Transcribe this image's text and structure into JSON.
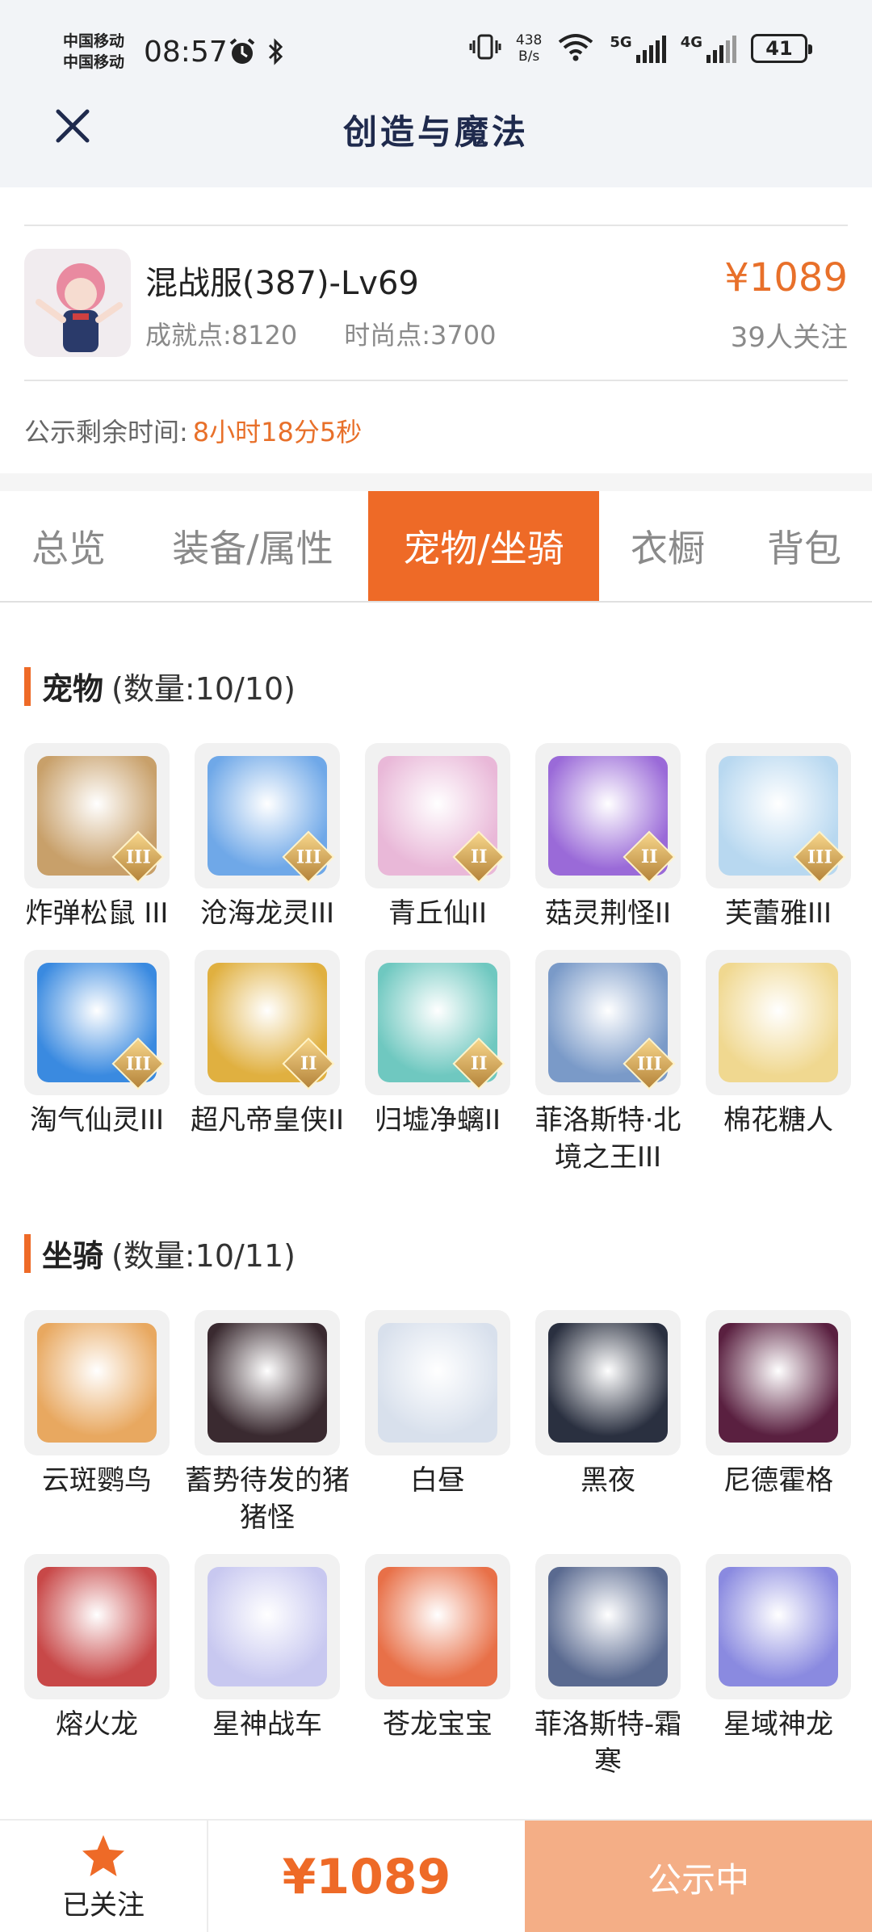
{
  "status_bar": {
    "carrier_1": "中国移动",
    "carrier_2": "中国移动",
    "time": "08:57",
    "net_speed_value": "438",
    "net_speed_unit": "B/s",
    "signal_1": "5G",
    "signal_2": "4G",
    "battery": "41"
  },
  "nav": {
    "title": "创造与魔法"
  },
  "account": {
    "title": "混战服(387)-Lv69",
    "achievement": "成就点:8120",
    "fashion": "时尚点:3700",
    "price": "¥1089",
    "followers": "39人关注",
    "countdown_label": "公示剩余时间:",
    "countdown_value": "8小时18分5秒"
  },
  "tabs": [
    {
      "label": "总览"
    },
    {
      "label": "装备/属性"
    },
    {
      "label": "宠物/坐骑"
    },
    {
      "label": "衣橱"
    },
    {
      "label": "背包"
    }
  ],
  "pets": {
    "title": "宠物",
    "count": "(数量:10/10)",
    "items": [
      {
        "name": "炸弹松鼠 III",
        "badge": "III",
        "color": "#c8a06a"
      },
      {
        "name": "沧海龙灵III",
        "badge": "III",
        "color": "#6fa8e8"
      },
      {
        "name": "青丘仙II",
        "badge": "II",
        "color": "#e9b8d8"
      },
      {
        "name": "菇灵荆怪II",
        "badge": "II",
        "color": "#9a6ad8"
      },
      {
        "name": "芙蕾雅III",
        "badge": "III",
        "color": "#b8d8f0"
      },
      {
        "name": "淘气仙灵III",
        "badge": "III",
        "color": "#3a8ae0"
      },
      {
        "name": "超凡帝皇侠II",
        "badge": "II",
        "color": "#e0b040"
      },
      {
        "name": "归墟净螭II",
        "badge": "II",
        "color": "#6fc8c0"
      },
      {
        "name": "菲洛斯特·北境之王III",
        "badge": "III",
        "color": "#7a9ac8"
      },
      {
        "name": "棉花糖人",
        "badge": "",
        "color": "#f0d890"
      }
    ]
  },
  "mounts": {
    "title": "坐骑",
    "count": "(数量:10/11)",
    "items": [
      {
        "name": "云斑鹦鸟",
        "color": "#e8a860"
      },
      {
        "name": "蓄势待发的猪猪怪",
        "color": "#3a2a30"
      },
      {
        "name": "白昼",
        "color": "#d8e0ec"
      },
      {
        "name": "黑夜",
        "color": "#2a3040"
      },
      {
        "name": "尼德霍格",
        "color": "#5a2040"
      },
      {
        "name": "熔火龙",
        "color": "#c84848"
      },
      {
        "name": "星神战车",
        "color": "#c8c8f0"
      },
      {
        "name": "苍龙宝宝",
        "color": "#e87048"
      },
      {
        "name": "菲洛斯特-霜寒",
        "color": "#5a6a90"
      },
      {
        "name": "星域神龙",
        "color": "#8a8ae0"
      }
    ]
  },
  "bottom": {
    "follow_label": "已关注",
    "price": "¥1089",
    "status_label": "公示中"
  }
}
